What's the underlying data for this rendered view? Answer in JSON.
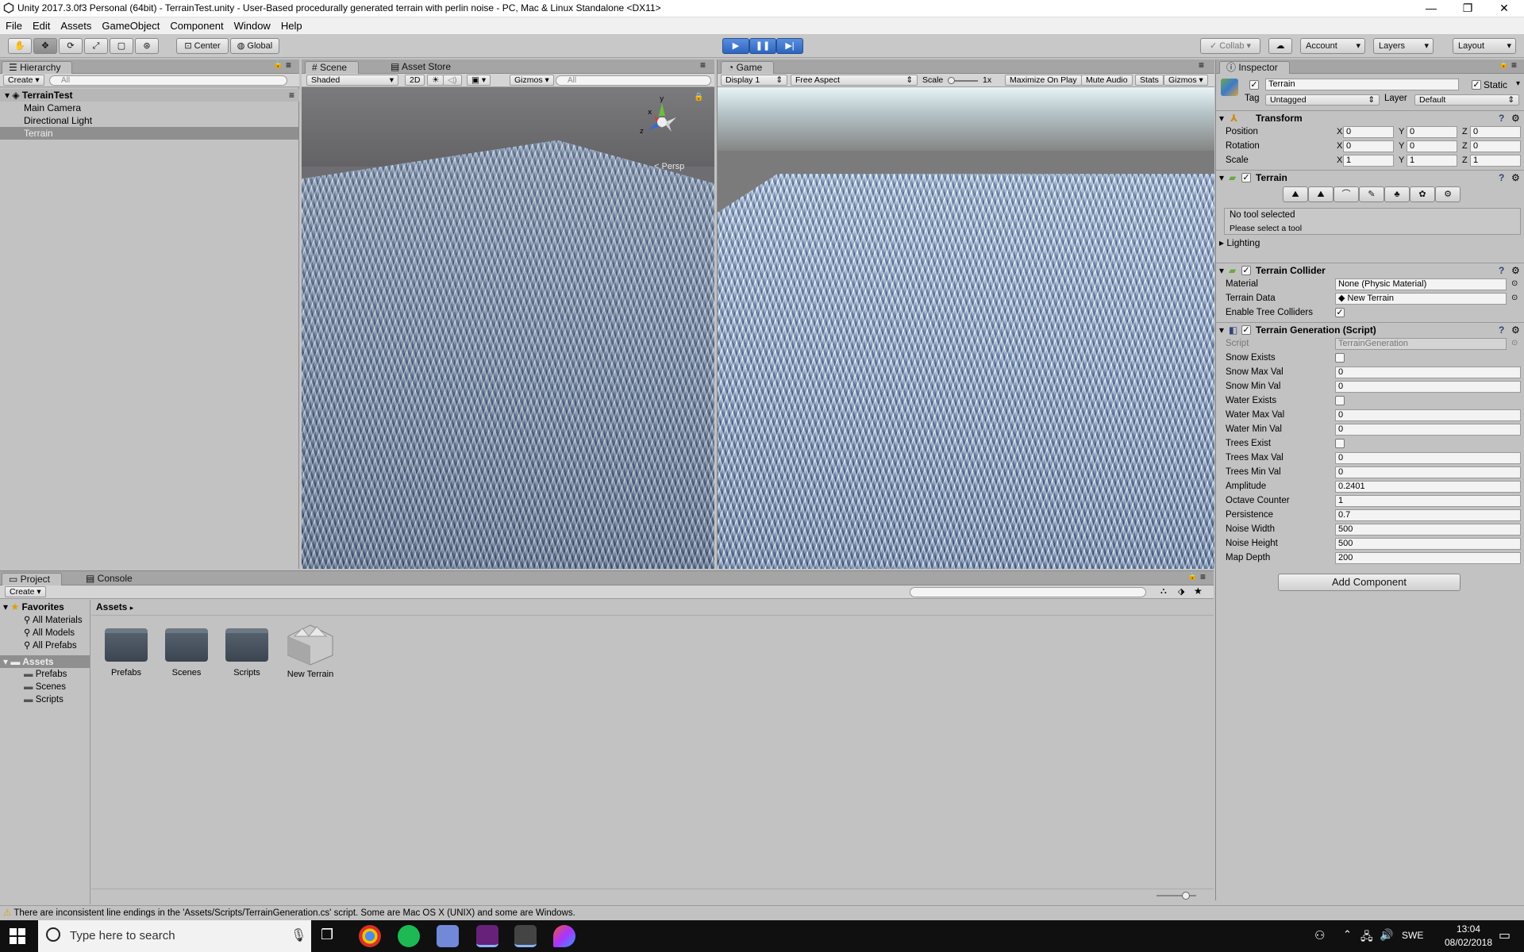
{
  "window": {
    "title": "Unity 2017.3.0f3 Personal (64bit) - TerrainTest.unity - User-Based procedurally generated terrain with perlin noise - PC, Mac & Linux Standalone <DX11>",
    "minimize": "—",
    "maximize": "❐",
    "close": "✕"
  },
  "menu": [
    "File",
    "Edit",
    "Assets",
    "GameObject",
    "Component",
    "Window",
    "Help"
  ],
  "toolbar": {
    "center": "Center",
    "global": "Global",
    "collab": "Collab",
    "account": "Account",
    "layers": "Layers",
    "layout": "Layout",
    "play_state": "playing"
  },
  "hierarchy": {
    "tab": "Hierarchy",
    "create": "Create",
    "search_placeholder": "All",
    "scene": "TerrainTest",
    "items": [
      "Main Camera",
      "Directional Light",
      "Terrain"
    ],
    "selected": "Terrain"
  },
  "scene": {
    "tab": "Scene",
    "tab2": "Asset Store",
    "shading": "Shaded",
    "mode2d": "2D",
    "gizmos": "Gizmos",
    "search_placeholder": "All",
    "persp": "Persp"
  },
  "game": {
    "tab": "Game",
    "display": "Display 1",
    "aspect": "Free Aspect",
    "scale_label": "Scale",
    "scale_value": "1x",
    "maximize": "Maximize On Play",
    "mute": "Mute Audio",
    "stats": "Stats",
    "gizmos": "Gizmos"
  },
  "inspector": {
    "tab": "Inspector",
    "name": "Terrain",
    "static": "Static",
    "tag_label": "Tag",
    "tag": "Untagged",
    "layer_label": "Layer",
    "layer": "Default",
    "transform": {
      "title": "Transform",
      "position": {
        "label": "Position",
        "x": "0",
        "y": "0",
        "z": "0"
      },
      "rotation": {
        "label": "Rotation",
        "x": "0",
        "y": "0",
        "z": "0"
      },
      "scale": {
        "label": "Scale",
        "x": "1",
        "y": "1",
        "z": "1"
      }
    },
    "terrain": {
      "title": "Terrain",
      "no_tool": "No tool selected",
      "please": "Please select a tool",
      "lighting": "Lighting"
    },
    "collider": {
      "title": "Terrain Collider",
      "material_label": "Material",
      "material": "None (Physic Material)",
      "data_label": "Terrain Data",
      "data": "New Terrain",
      "trees_label": "Enable Tree Colliders"
    },
    "script": {
      "title": "Terrain Generation (Script)",
      "script_label": "Script",
      "script": "TerrainGeneration",
      "fields": [
        {
          "label": "Snow Exists",
          "type": "check",
          "value": ""
        },
        {
          "label": "Snow Max Val",
          "type": "text",
          "value": "0"
        },
        {
          "label": "Snow Min Val",
          "type": "text",
          "value": "0"
        },
        {
          "label": "Water Exists",
          "type": "check",
          "value": ""
        },
        {
          "label": "Water Max Val",
          "type": "text",
          "value": "0"
        },
        {
          "label": "Water Min Val",
          "type": "text",
          "value": "0"
        },
        {
          "label": "Trees Exist",
          "type": "check",
          "value": ""
        },
        {
          "label": "Trees Max Val",
          "type": "text",
          "value": "0"
        },
        {
          "label": "Trees Min Val",
          "type": "text",
          "value": "0"
        },
        {
          "label": "Amplitude",
          "type": "text",
          "value": "0.2401"
        },
        {
          "label": "Octave Counter",
          "type": "text",
          "value": "1"
        },
        {
          "label": "Persistence",
          "type": "text",
          "value": "0.7"
        },
        {
          "label": "Noise Width",
          "type": "text",
          "value": "500"
        },
        {
          "label": "Noise Height",
          "type": "text",
          "value": "500"
        },
        {
          "label": "Map Depth",
          "type": "text",
          "value": "200"
        }
      ]
    },
    "add_component": "Add Component"
  },
  "project": {
    "tab": "Project",
    "tab2": "Console",
    "create": "Create",
    "favorites": "Favorites",
    "fav_items": [
      "All Materials",
      "All Models",
      "All Prefabs"
    ],
    "assets": "Assets",
    "asset_folders": [
      "Prefabs",
      "Scenes",
      "Scripts"
    ],
    "breadcrumb": "Assets",
    "grid": [
      {
        "name": "Prefabs",
        "kind": "folder"
      },
      {
        "name": "Scenes",
        "kind": "folder"
      },
      {
        "name": "Scripts",
        "kind": "folder"
      },
      {
        "name": "New Terrain",
        "kind": "terrain"
      }
    ]
  },
  "status": "There are inconsistent line endings in the 'Assets/Scripts/TerrainGeneration.cs' script. Some are Mac OS X (UNIX) and some are Windows.",
  "taskbar": {
    "search": "Type here to search",
    "lang": "SWE",
    "time": "13:04",
    "date": "08/02/2018"
  },
  "colors": {
    "play_blue": "#3d74d0",
    "selection": "#8f8f8f",
    "panel": "#c2c2c2"
  }
}
